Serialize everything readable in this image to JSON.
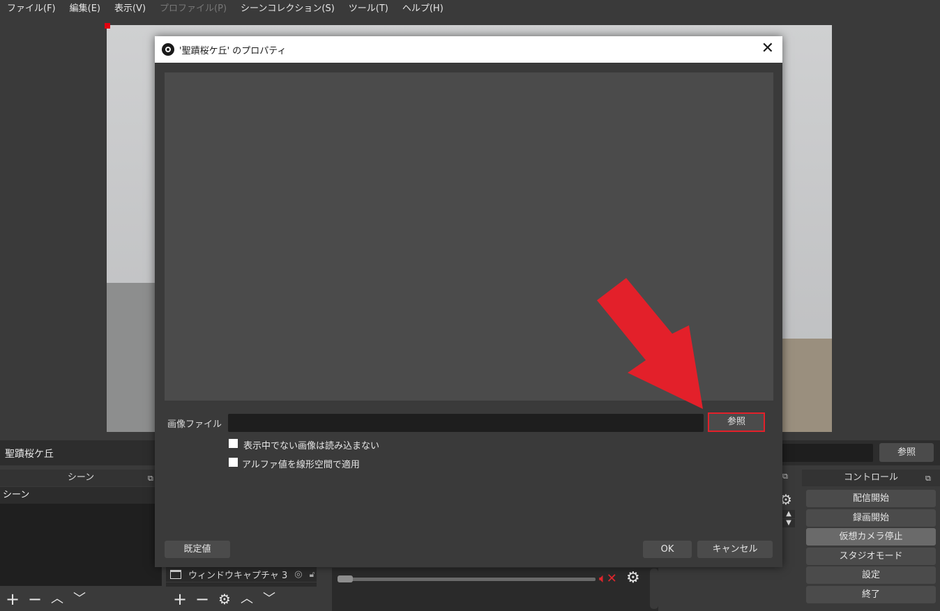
{
  "menubar": {
    "items": [
      {
        "label": "ファイル(F)",
        "enabled": true
      },
      {
        "label": "編集(E)",
        "enabled": true
      },
      {
        "label": "表示(V)",
        "enabled": true
      },
      {
        "label": "プロファイル(P)",
        "enabled": false
      },
      {
        "label": "シーンコレクション(S)",
        "enabled": true
      },
      {
        "label": "ツール(T)",
        "enabled": true
      },
      {
        "label": "ヘルプ(H)",
        "enabled": true
      }
    ]
  },
  "source_bar": {
    "source_name": "聖蹟桜ケ丘",
    "browse_label": "参照"
  },
  "scenes": {
    "title": "シーン",
    "items": [
      "シーン"
    ],
    "toolbar_icons": [
      "plus-icon",
      "minus-icon",
      "arrow-up-icon",
      "arrow-down-icon"
    ]
  },
  "sources": {
    "items": [
      {
        "label": "ウィンドウキャプチャ 3"
      }
    ],
    "toolbar_icons": [
      "plus-icon",
      "minus-icon",
      "gear-icon",
      "arrow-up-icon",
      "arrow-down-icon"
    ]
  },
  "controls": {
    "title": "コントロール",
    "buttons": [
      {
        "label": "配信開始",
        "active": false
      },
      {
        "label": "録画開始",
        "active": false
      },
      {
        "label": "仮想カメラ停止",
        "active": true
      },
      {
        "label": "スタジオモード",
        "active": false
      },
      {
        "label": "設定",
        "active": false
      },
      {
        "label": "終了",
        "active": false
      }
    ]
  },
  "dialog": {
    "title": "'聖蹟桜ケ丘' のプロパティ",
    "image_file_label": "画像ファイル",
    "image_file_value": "",
    "browse_label": "参照",
    "checkboxes": [
      {
        "label": "表示中でない画像は読み込まない",
        "checked": false
      },
      {
        "label": "アルファ値を線形空間で適用",
        "checked": false
      }
    ],
    "defaults_label": "既定値",
    "ok_label": "OK",
    "cancel_label": "キャンセル"
  },
  "colors": {
    "annotation_red": "#e3202a",
    "panel_bg": "#3a3a3a",
    "button_bg": "#4b4b4b"
  }
}
